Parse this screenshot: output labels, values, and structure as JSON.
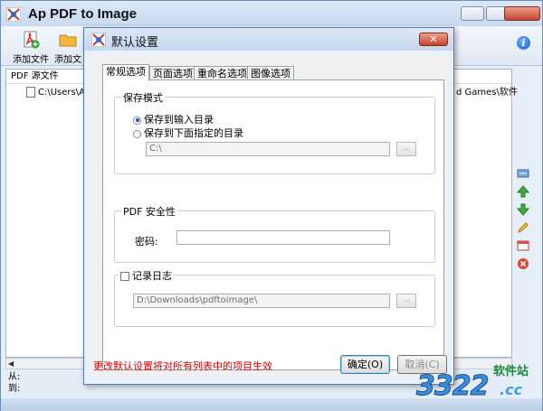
{
  "main_window": {
    "title": "Ap PDF to Image",
    "toolbar": {
      "add_file_label": "添加文件",
      "add_folder_label": "添加文"
    },
    "file_list": {
      "column_header": "PDF 源文件",
      "rows": [
        {
          "path_start": "C:\\Users\\Adm",
          "path_end": "d Games\\软件"
        }
      ]
    },
    "status": {
      "from_label": "从:",
      "to_label": "到:"
    }
  },
  "dialog": {
    "title": "默认设置",
    "close_glyph": "✕",
    "tabs": [
      {
        "label": "常规选项",
        "active": true
      },
      {
        "label": "页面选项",
        "active": false
      },
      {
        "label": "重命名选项",
        "active": false
      },
      {
        "label": "图像选项",
        "active": false
      }
    ],
    "save_mode": {
      "legend": "保存模式",
      "option_input_dir": "保存到输入目录",
      "option_specified_dir": "保存到下面指定的目录",
      "selected": "option_input_dir",
      "path_value": "C:\\",
      "browse_label": "..."
    },
    "pdf_security": {
      "legend": "PDF 安全性",
      "password_label": "密码:",
      "password_value": ""
    },
    "log": {
      "checkbox_label": "记录日志",
      "checked": false,
      "path_value": "D:\\Downloads\\pdftoimage\\",
      "browse_label": "..."
    },
    "note": "更改默认设置将对所有列表中的项目生效",
    "ok_label": "确定(O)",
    "cancel_label": "取消(C)"
  },
  "watermark": {
    "brand": "软件站",
    "number": "3322",
    "domain": ".cc"
  },
  "colors": {
    "note_red": "#e00000",
    "accent_blue": "#1a4fc0",
    "watermark_green": "#1a8a3a"
  }
}
